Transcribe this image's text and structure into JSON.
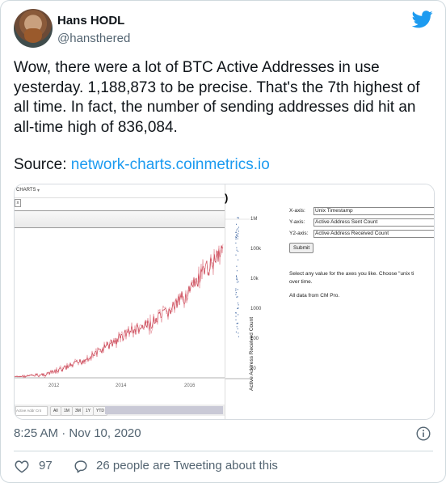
{
  "author": {
    "display_name": "Hans HODL",
    "handle": "@hansthered"
  },
  "tweet": {
    "text": "Wow, there were a lot of BTC Active Addresses in use yesterday. 1,188,873 to be precise. That's the 7th highest of all time. In fact, the number of sending addresses did hit an all-time high of 836,084.",
    "source_prefix": "Source: ",
    "source_link": "network-charts.coinmetrics.io",
    "timestamp": "8:25 AM · Nov 10, 2020"
  },
  "actions": {
    "likes": "97",
    "reply_text": "26 people are Tweeting about this"
  },
  "media": {
    "chart_header": "CHARTS",
    "close_box": "x",
    "range_input": "Active Addr Cnt",
    "range_buttons": [
      "All",
      "1M",
      "3M",
      "1Y",
      "YTD"
    ],
    "x_tick_labels": [
      "2012",
      "2014",
      "2016"
    ],
    "y_tick_labels": [
      "1M",
      "100k",
      "10k",
      "1000",
      "100",
      "10"
    ],
    "y2_axis_label": "Active Address Received Count",
    "paren": ")",
    "form": {
      "x_label": "X-axis:",
      "x_value": "Unix Timestamp",
      "y_label": "Y-axis:",
      "y_value": "Active Address Sent Count",
      "y2_label": "Y2-axis:",
      "y2_value": "Active Address Received Count",
      "submit": "Submit",
      "note1": "Select any value for the axes you like. Choose \"unix ti",
      "note1b": "over time.",
      "note2": "All data from CM Pro."
    }
  },
  "colors": {
    "link": "#1d9bf0",
    "secondary_text": "#536471",
    "series_line": "#c0283a"
  },
  "icons": {
    "brand": "twitter-bird-icon",
    "info": "info-icon",
    "like": "heart-icon",
    "reply": "speech-bubble-icon"
  }
}
